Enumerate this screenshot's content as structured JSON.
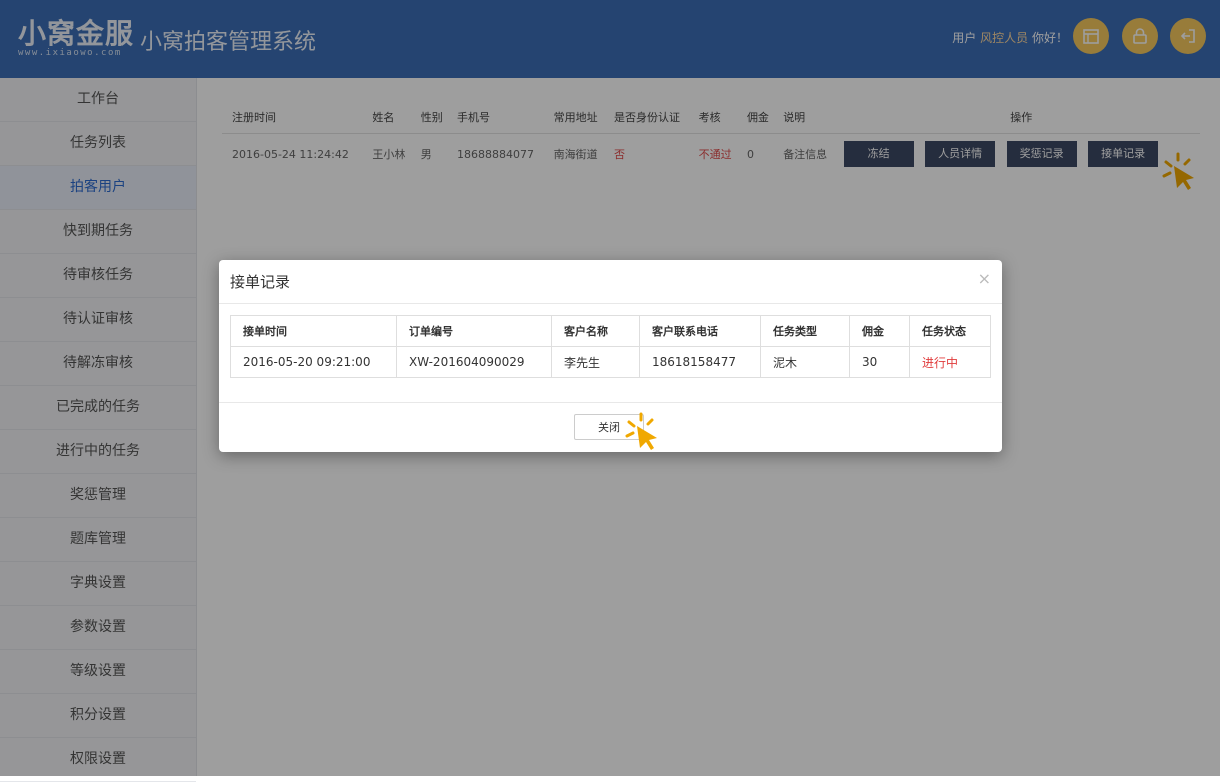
{
  "header": {
    "logo_text": "小窝金服",
    "logo_url": "www.ixiaowo.com",
    "system_title": "小窝拍客管理系统",
    "greeting_prefix": "用户",
    "username": "风控人员",
    "greeting_suffix": "你好！"
  },
  "sidebar": {
    "items": [
      {
        "label": "工作台"
      },
      {
        "label": "任务列表"
      },
      {
        "label": "拍客用户"
      },
      {
        "label": "快到期任务"
      },
      {
        "label": "待审核任务"
      },
      {
        "label": "待认证审核"
      },
      {
        "label": "待解冻审核"
      },
      {
        "label": "已完成的任务"
      },
      {
        "label": "进行中的任务"
      },
      {
        "label": "奖惩管理"
      },
      {
        "label": "题库管理"
      },
      {
        "label": "字典设置"
      },
      {
        "label": "参数设置"
      },
      {
        "label": "等级设置"
      },
      {
        "label": "积分设置"
      },
      {
        "label": "权限设置"
      }
    ]
  },
  "main_table": {
    "headers": [
      "注册时间",
      "姓名",
      "性别",
      "手机号",
      "常用地址",
      "是否身份认证",
      "考核",
      "佣金",
      "说明",
      "操作"
    ],
    "row": {
      "reg_time": "2016-05-24 11:24:42",
      "name": "王小林",
      "gender": "男",
      "phone": "18688884077",
      "address": "南海街道",
      "verified": "否",
      "review": "不通过",
      "commission": "0",
      "note": "备注信息"
    },
    "actions": [
      "冻结",
      "人员详情",
      "奖惩记录",
      "接单记录"
    ]
  },
  "modal": {
    "title": "接单记录",
    "close_symbol": "×",
    "headers": [
      "接单时间",
      "订单编号",
      "客户名称",
      "客户联系电话",
      "任务类型",
      "佣金",
      "任务状态"
    ],
    "row": {
      "time": "2016-05-20 09:21:00",
      "order_no": "XW-201604090029",
      "customer": "李先生",
      "phone": "18618158477",
      "type": "泥木",
      "commission": "30",
      "status": "进行中"
    },
    "close_button": "关闭"
  }
}
